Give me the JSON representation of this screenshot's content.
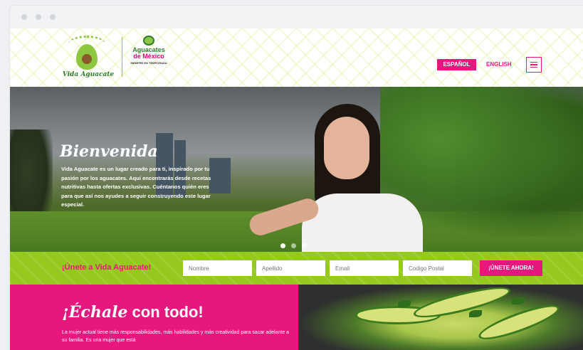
{
  "header": {
    "logo_vida_text": "Vida Aguacate",
    "logo_mex_line1": "Aguacates",
    "logo_mex_line2": "de México",
    "logo_mex_tagline": "SIEMPRE EN TEMPORADA",
    "lang_es": "ESPAÑOL",
    "lang_en": "ENGLISH"
  },
  "hero": {
    "title": "Bienvenida",
    "body": "Vida Aguacate es un lugar creado para ti, inspirado por tu pasión por los aguacates. Aquí encontrarás desde recetas nutritivas hasta ofertas exclusivas. Cuéntanos quién eres para que así nos ayudes a seguir construyendo este lugar especial."
  },
  "signup": {
    "title": "¡Únete a Vida Aguacate!",
    "fields": [
      {
        "placeholder": "Nombre"
      },
      {
        "placeholder": "Apellido"
      },
      {
        "placeholder": "Email"
      },
      {
        "placeholder": "Codigo Postal"
      }
    ],
    "button": "¡ÚNETE AHORA!"
  },
  "promo": {
    "title_script": "¡Échale",
    "title_rest": " con todo!",
    "body": "La mujer actual tiene más responsabilidades, más habilidades y más creatividad para sacar adelante a su familia. Es una mujer que está"
  },
  "colors": {
    "accent_pink": "#e6187e",
    "accent_green": "#95c91e"
  }
}
